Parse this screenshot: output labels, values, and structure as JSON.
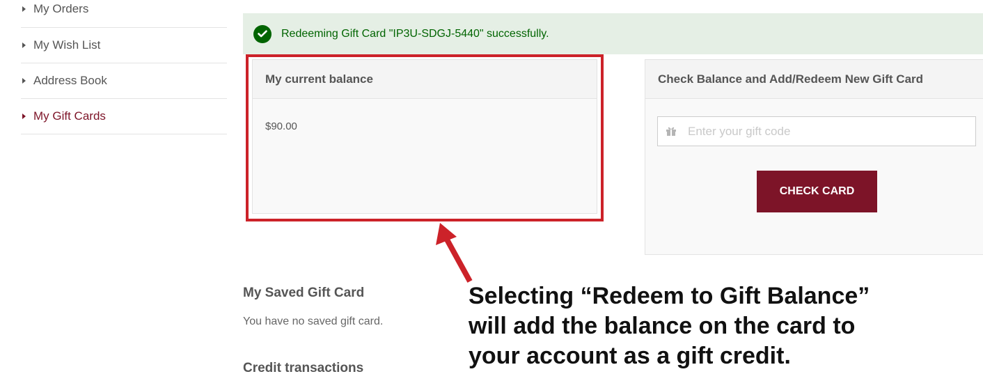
{
  "sidebar": {
    "items": [
      {
        "label": "My Orders",
        "active": false
      },
      {
        "label": "My Wish List",
        "active": false
      },
      {
        "label": "Address Book",
        "active": false
      },
      {
        "label": "My Gift Cards",
        "active": true
      }
    ]
  },
  "banner": {
    "message": "Redeeming Gift Card \"IP3U-SDGJ-5440\" successfully.",
    "icon": "check-circle-icon",
    "color": "#006400",
    "background": "#e5efe5"
  },
  "balance": {
    "title": "My current balance",
    "value": "$90.00"
  },
  "check_balance": {
    "title": "Check Balance and Add/Redeem New Gift Card",
    "input_placeholder": "Enter your gift code",
    "input_icon": "gift-icon",
    "button_label": "CHECK CARD",
    "button_color": "#7d1428"
  },
  "saved_card": {
    "title": "My Saved Gift Card",
    "text": "You have no saved gift card."
  },
  "credit": {
    "title": "Credit transactions"
  },
  "annotation": {
    "text": "Selecting “Redeem to Gift Balance”\nwill add the balance on the card to\nyour account as a gift credit.",
    "highlight_color": "#cc2229"
  }
}
